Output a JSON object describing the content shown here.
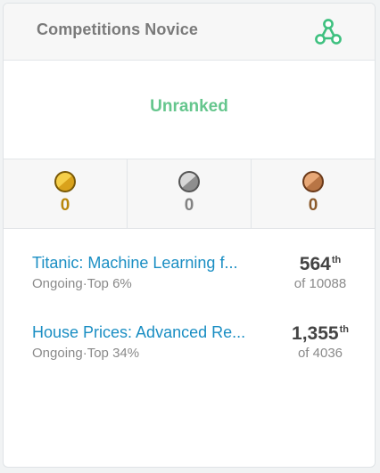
{
  "header": {
    "title": "Competitions Novice",
    "tier_icon": "network-nodes-icon",
    "accent": "#3ec07f"
  },
  "rank": {
    "label": "Unranked",
    "color": "#65c68d"
  },
  "medals": [
    {
      "type": "gold",
      "icon": "gold-medal-icon",
      "count": "0",
      "color": "#d9a21b"
    },
    {
      "type": "silver",
      "icon": "silver-medal-icon",
      "count": "0",
      "color": "#8e8e8e"
    },
    {
      "type": "bronze",
      "icon": "bronze-medal-icon",
      "count": "0",
      "color": "#b87545"
    }
  ],
  "competitions": [
    {
      "name": "Titanic: Machine Learning f...",
      "status": "Ongoing",
      "top": "Top 6%",
      "rank": "564",
      "suffix": "th",
      "of": "of 10088"
    },
    {
      "name": "House Prices: Advanced Re...",
      "status": "Ongoing",
      "top": "Top 34%",
      "rank": "1,355",
      "suffix": "th",
      "of": "of 4036"
    }
  ]
}
